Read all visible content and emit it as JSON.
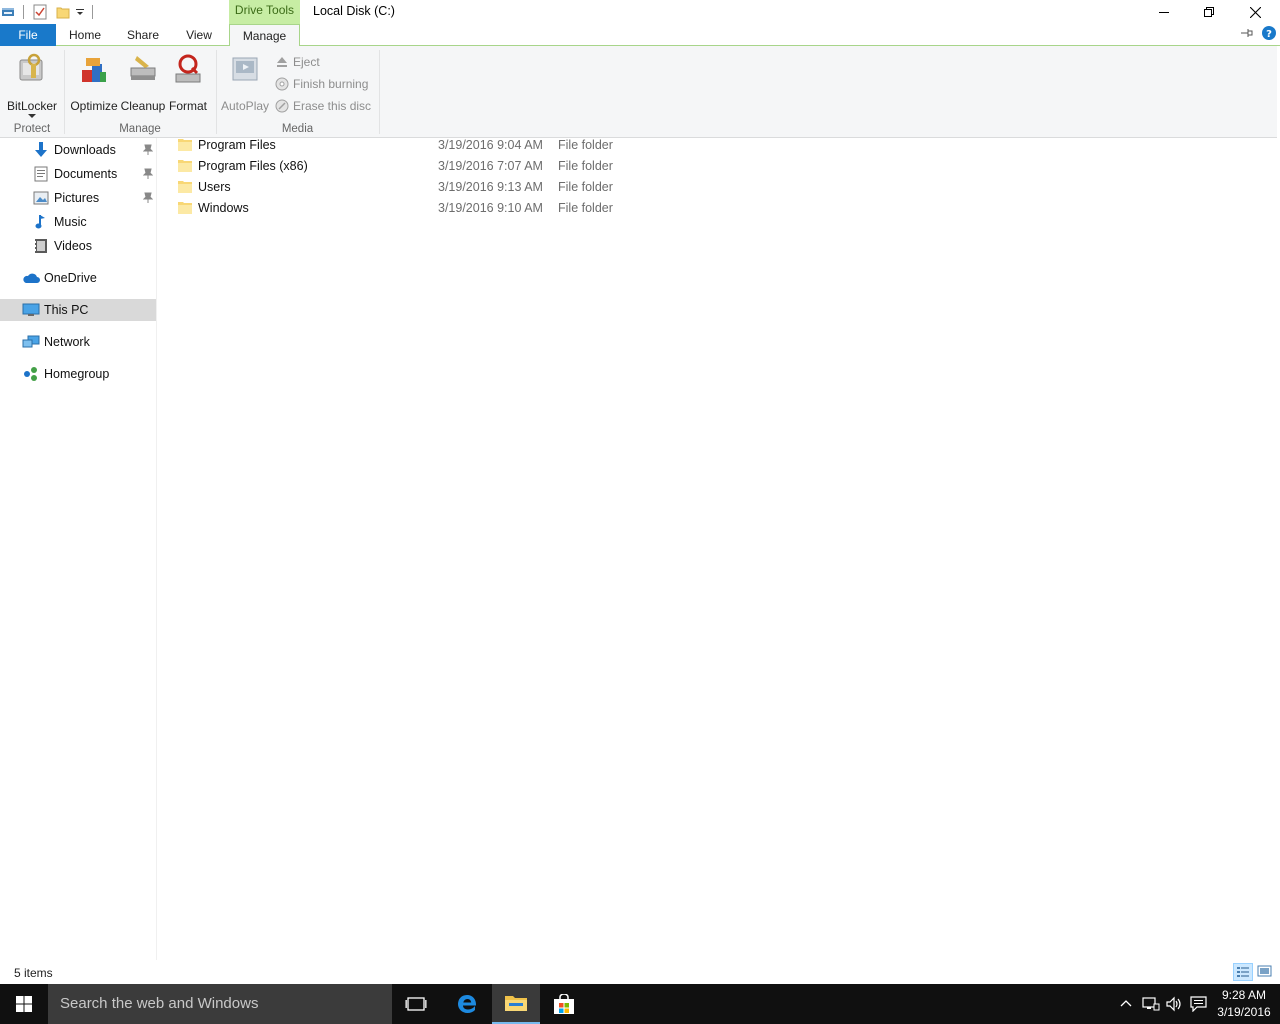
{
  "window": {
    "title": "Local Disk (C:)",
    "context_tab_title": "Drive Tools"
  },
  "ribbon": {
    "tabs": [
      "File",
      "Home",
      "Share",
      "View",
      "Manage"
    ],
    "active_tab": "Manage",
    "groups": {
      "protect": {
        "label": "Protect",
        "buttons": [
          "BitLocker"
        ]
      },
      "manage": {
        "label": "Manage",
        "buttons": [
          "Optimize",
          "Cleanup",
          "Format"
        ]
      },
      "media": {
        "label": "Media",
        "autoplay": "AutoPlay",
        "small_buttons": [
          "Eject",
          "Finish burning",
          "Erase this disc"
        ]
      }
    }
  },
  "nav": {
    "items": [
      {
        "label": "Downloads",
        "icon": "download-arrow-icon",
        "pinned": true
      },
      {
        "label": "Documents",
        "icon": "documents-icon",
        "pinned": true
      },
      {
        "label": "Pictures",
        "icon": "pictures-icon",
        "pinned": true
      },
      {
        "label": "Music",
        "icon": "music-note-icon",
        "pinned": false
      },
      {
        "label": "Videos",
        "icon": "videos-icon",
        "pinned": false
      },
      {
        "label": "OneDrive",
        "icon": "onedrive-cloud-icon",
        "pinned": false
      },
      {
        "label": "This PC",
        "icon": "computer-icon",
        "pinned": false,
        "selected": true
      },
      {
        "label": "Network",
        "icon": "network-icon",
        "pinned": false
      },
      {
        "label": "Homegroup",
        "icon": "homegroup-icon",
        "pinned": false
      }
    ]
  },
  "files": {
    "rows": [
      {
        "name": "Program Files",
        "date": "3/19/2016 9:04 AM",
        "type": "File folder"
      },
      {
        "name": "Program Files (x86)",
        "date": "3/19/2016 7:07 AM",
        "type": "File folder"
      },
      {
        "name": "Users",
        "date": "3/19/2016 9:13 AM",
        "type": "File folder"
      },
      {
        "name": "Windows",
        "date": "3/19/2016 9:10 AM",
        "type": "File folder"
      }
    ]
  },
  "status": {
    "item_count": "5 items"
  },
  "taskbar": {
    "search_placeholder": "Search the web and Windows",
    "time": "9:28 AM",
    "date": "3/19/2016"
  },
  "colors": {
    "file_tab": "#1979ca",
    "context_tab": "#c7eda4",
    "taskbar": "#101010",
    "selected_nav": "#d9d9d9"
  }
}
